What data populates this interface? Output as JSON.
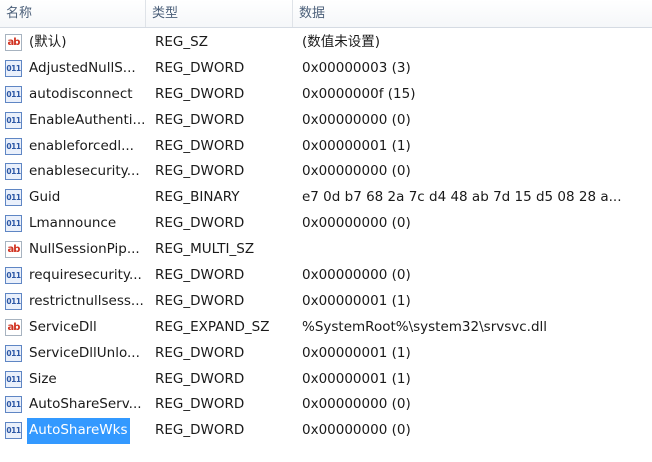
{
  "columns": [
    "名称",
    "类型",
    "数据"
  ],
  "entries": [
    {
      "icon": "string-value-icon",
      "glyph": "ab",
      "name": "(默认)",
      "type": "REG_SZ",
      "data": "(数值未设置)"
    },
    {
      "icon": "binary-value-icon",
      "glyph": "011",
      "name": "AdjustedNullS...",
      "type": "REG_DWORD",
      "data": "0x00000003 (3)"
    },
    {
      "icon": "binary-value-icon",
      "glyph": "011",
      "name": "autodisconnect",
      "type": "REG_DWORD",
      "data": "0x0000000f (15)"
    },
    {
      "icon": "binary-value-icon",
      "glyph": "011",
      "name": "EnableAuthenti...",
      "type": "REG_DWORD",
      "data": "0x00000000 (0)"
    },
    {
      "icon": "binary-value-icon",
      "glyph": "011",
      "name": "enableforcedl...",
      "type": "REG_DWORD",
      "data": "0x00000001 (1)"
    },
    {
      "icon": "binary-value-icon",
      "glyph": "011",
      "name": "enablesecurity...",
      "type": "REG_DWORD",
      "data": "0x00000000 (0)"
    },
    {
      "icon": "binary-value-icon",
      "glyph": "011",
      "name": "Guid",
      "type": "REG_BINARY",
      "data": "e7 0d b7 68 2a 7c d4 48 ab 7d 15 d5 08 28 a..."
    },
    {
      "icon": "binary-value-icon",
      "glyph": "011",
      "name": "Lmannounce",
      "type": "REG_DWORD",
      "data": "0x00000000 (0)"
    },
    {
      "icon": "string-value-icon",
      "glyph": "ab",
      "name": "NullSessionPip...",
      "type": "REG_MULTI_SZ",
      "data": ""
    },
    {
      "icon": "binary-value-icon",
      "glyph": "011",
      "name": "requiresecurity...",
      "type": "REG_DWORD",
      "data": "0x00000000 (0)"
    },
    {
      "icon": "binary-value-icon",
      "glyph": "011",
      "name": "restrictnullsess...",
      "type": "REG_DWORD",
      "data": "0x00000001 (1)"
    },
    {
      "icon": "string-value-icon",
      "glyph": "ab",
      "name": "ServiceDll",
      "type": "REG_EXPAND_SZ",
      "data": "%SystemRoot%\\system32\\srvsvc.dll"
    },
    {
      "icon": "binary-value-icon",
      "glyph": "011",
      "name": "ServiceDllUnlo...",
      "type": "REG_DWORD",
      "data": "0x00000001 (1)"
    },
    {
      "icon": "binary-value-icon",
      "glyph": "011",
      "name": "Size",
      "type": "REG_DWORD",
      "data": "0x00000001 (1)"
    },
    {
      "icon": "binary-value-icon",
      "glyph": "011",
      "name": "AutoShareServ...",
      "type": "REG_DWORD",
      "data": "0x00000000 (0)"
    },
    {
      "icon": "binary-value-icon",
      "glyph": "011",
      "name": "AutoShareWks",
      "type": "REG_DWORD",
      "data": "0x00000000 (0)",
      "selected": true
    }
  ],
  "colors": {
    "selection": "#3399ff",
    "header_text": "#4c607a"
  }
}
